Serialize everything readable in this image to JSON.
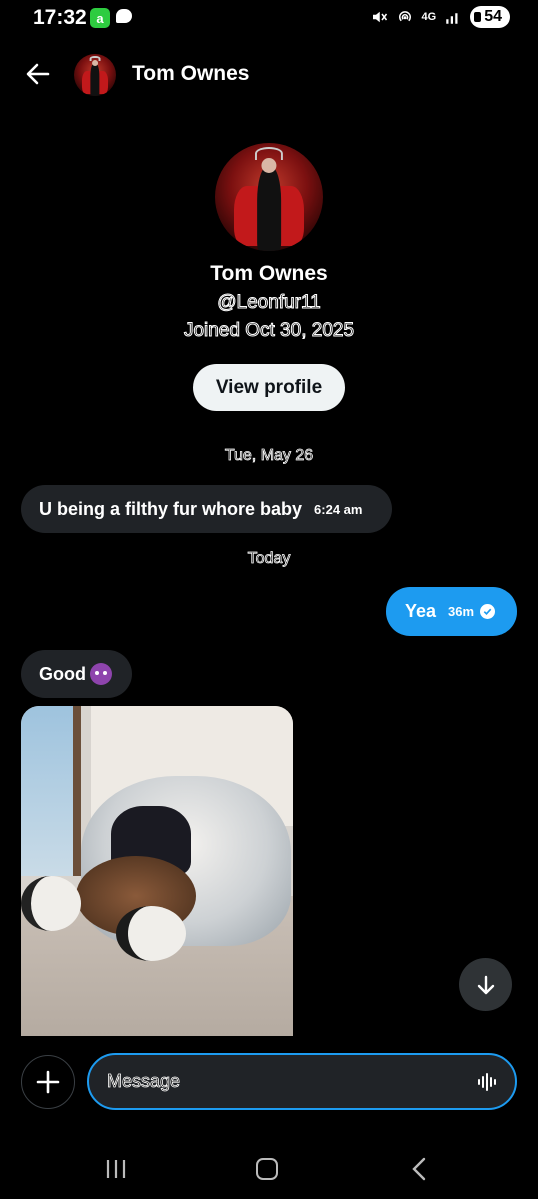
{
  "status_bar": {
    "time": "17:32",
    "app_badge": "a",
    "network": "4G",
    "battery": "54"
  },
  "header": {
    "contact_name": "Tom Ownes"
  },
  "profile": {
    "name": "Tom Ownes",
    "handle": "@Leonfur11",
    "joined": "Joined Oct 30, 2025",
    "view_profile_label": "View profile"
  },
  "conversation": {
    "date_separator_1": "Tue, May 26",
    "date_separator_2": "Today",
    "messages": [
      {
        "direction": "in",
        "text": "U being a filthy fur whore baby",
        "time": "6:24 am"
      },
      {
        "direction": "out",
        "text": "Yea",
        "time": "36m",
        "status": "seen"
      },
      {
        "direction": "in",
        "text": "Good",
        "emoji": "smiling-devil"
      },
      {
        "direction": "in",
        "type": "image"
      }
    ]
  },
  "composer": {
    "placeholder": "Message"
  },
  "colors": {
    "accent": "#1d9bf0",
    "incoming_bubble": "#202327",
    "background": "#000000"
  }
}
